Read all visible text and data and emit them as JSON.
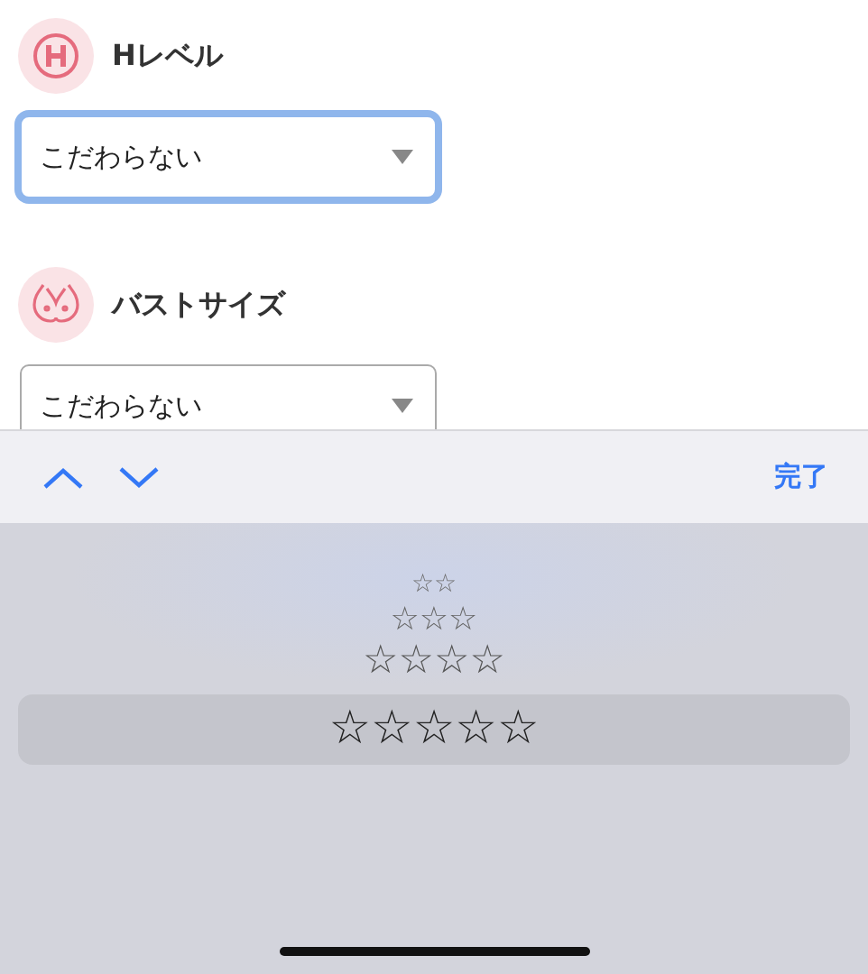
{
  "filters": [
    {
      "kind": "h-letter",
      "label": "Hレベル",
      "value": "こだわらない",
      "focused": true
    },
    {
      "kind": "bust",
      "label": "バストサイズ",
      "value": "こだわらない",
      "focused": false
    }
  ],
  "toolbar": {
    "done": "完了"
  },
  "picker": {
    "options": [
      {
        "label": "☆☆",
        "selected": false
      },
      {
        "label": "☆☆☆",
        "selected": false
      },
      {
        "label": "☆☆☆☆",
        "selected": false
      },
      {
        "label": "☆☆☆☆☆",
        "selected": true
      }
    ]
  }
}
